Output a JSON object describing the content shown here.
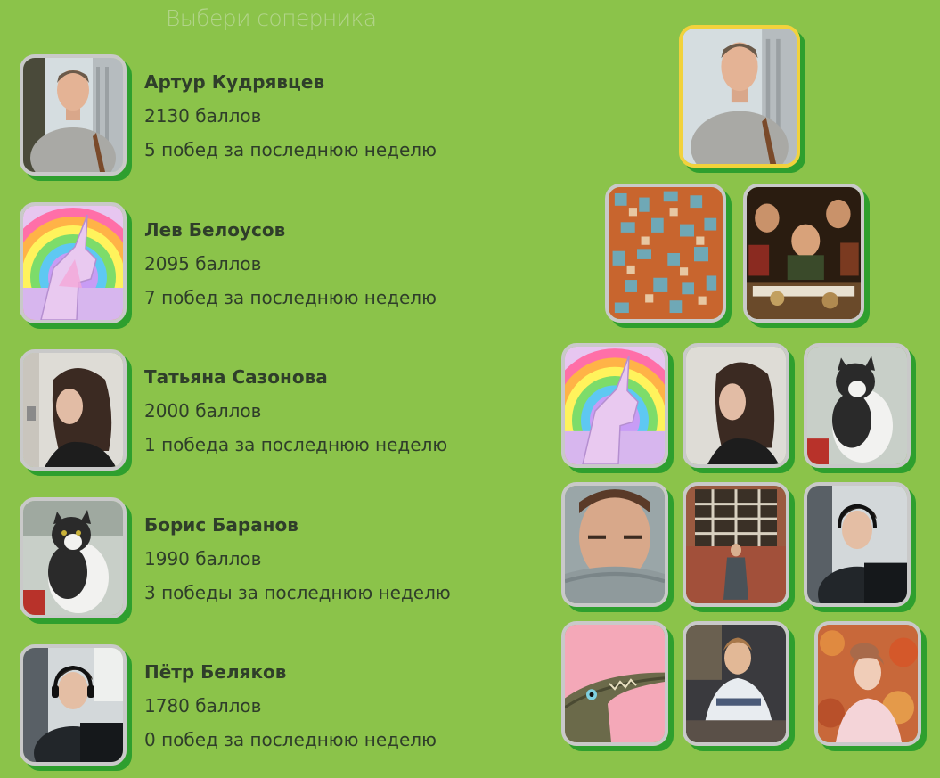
{
  "page": {
    "title": "Выбери соперника"
  },
  "players": [
    {
      "name": "Артур Кудрявцев",
      "score": "2130 баллов",
      "wins": "5 побед за последнюю неделю",
      "avatar": "photo-man-grey-shirt"
    },
    {
      "name": "Лев Белоусов",
      "score": "2095 баллов",
      "wins": "7 побед за последнюю неделю",
      "avatar": "rainbow-unicorn-image"
    },
    {
      "name": "Татьяна Сазонова",
      "score": "2000 баллов",
      "wins": "1 победа за последнюю неделю",
      "avatar": "photo-woman-dark-hair"
    },
    {
      "name": "Борис Баранов",
      "score": "1990 баллов",
      "wins": "3 победы за последнюю неделю",
      "avatar": "photo-fat-cat"
    },
    {
      "name": "Пётр Беляков",
      "score": "1780 баллов",
      "wins": "0 побед за последнюю неделю",
      "avatar": "photo-man-headset"
    }
  ],
  "pyramid": {
    "rows": [
      [
        "photo-man-grey-shirt"
      ],
      [
        "mosaic-art",
        "painting-feast"
      ],
      [
        "rainbow-unicorn-image",
        "photo-woman-dark-hair",
        "photo-fat-cat"
      ],
      [
        "photo-man-scarf",
        "photo-woman-window",
        "photo-man-headset"
      ],
      [
        "photo-crocodile",
        "photo-man-sweater",
        "photo-woman-autumn"
      ]
    ]
  },
  "colors": {
    "background": "#8bc34a",
    "shadow": "#2e9f2e",
    "frame": "#c9c9c9",
    "leader_frame": "#f2d23c",
    "text": "#2f3e2a"
  }
}
